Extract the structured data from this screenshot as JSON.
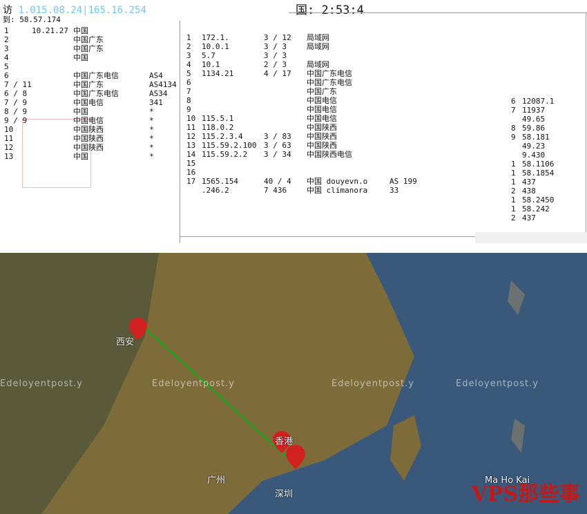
{
  "window": {
    "title_prefix": "访",
    "title_ip": "1.015.08.24|165.16.254",
    "subtitle": "到: 58.57.174",
    "title2": "国: 2:53:4"
  },
  "trace": {
    "left_rows": [
      {
        "hop": "1",
        "ip": "10.21.27",
        "geo": "中国",
        "asn": ""
      },
      {
        "hop": "2",
        "ip": "",
        "geo": "中国广东",
        "asn": ""
      },
      {
        "hop": "3",
        "ip": "",
        "geo": "中国广东",
        "asn": ""
      },
      {
        "hop": "4",
        "ip": "",
        "geo": "中国",
        "asn": ""
      },
      {
        "hop": "5",
        "ip": "",
        "geo": "",
        "asn": ""
      },
      {
        "hop": "6",
        "ip": "",
        "geo": "中国广东电信",
        "asn": "AS4"
      },
      {
        "hop": "7 / 11",
        "ip": "",
        "geo": "中国广东",
        "asn": "AS4134"
      },
      {
        "hop": "6 / 8",
        "ip": "",
        "geo": "中国广东电信",
        "asn": "AS34"
      },
      {
        "hop": "7 / 9",
        "ip": "",
        "geo": "中国电信",
        "asn": "341"
      },
      {
        "hop": "8 / 9",
        "ip": "",
        "geo": "中国",
        "asn": "*"
      },
      {
        "hop": "9 / 9",
        "ip": "",
        "geo": "中国电信",
        "asn": "*"
      },
      {
        "hop": "10",
        "ip": "",
        "geo": "中国陕西",
        "asn": "*"
      },
      {
        "hop": "11",
        "ip": "",
        "geo": "中国陕西",
        "asn": "*"
      },
      {
        "hop": "12",
        "ip": "",
        "geo": "中国陕西",
        "asn": "*"
      },
      {
        "hop": "13",
        "ip": "",
        "geo": "中国",
        "asn": "*"
      }
    ],
    "mid_rows": [
      {
        "hop": "1",
        "ip": "172.1.",
        "loss": "3 / 12",
        "geo": "局域网"
      },
      {
        "hop": "2",
        "ip": "10.0.1",
        "loss": "3 / 3",
        "geo": "局域网"
      },
      {
        "hop": "3",
        "ip": "5.7",
        "loss": "3 / 3",
        "geo": ""
      },
      {
        "hop": "4",
        "ip": "10.1",
        "loss": "2 / 3",
        "geo": "局域网"
      },
      {
        "hop": "5",
        "ip": "1134.21",
        "loss": "4 / 17",
        "geo": "中国广东电信"
      },
      {
        "hop": "6",
        "ip": "",
        "loss": "",
        "geo": "中国广东电信"
      },
      {
        "hop": "7",
        "ip": "",
        "loss": "",
        "geo": "中国广东"
      },
      {
        "hop": "8",
        "ip": "",
        "loss": "",
        "geo": "中国电信"
      },
      {
        "hop": "9",
        "ip": "",
        "loss": "",
        "geo": "中国电信"
      },
      {
        "hop": "10",
        "ip": "115.5.1",
        "loss": "",
        "geo": "中国电信"
      },
      {
        "hop": "11",
        "ip": "118.0.2",
        "loss": "",
        "geo": "中国陕西"
      },
      {
        "hop": "12",
        "ip": "115.2.3.4",
        "loss": "3 / 83",
        "geo": "中国陕西"
      },
      {
        "hop": "13",
        "ip": "115.59.2.100",
        "loss": "3 / 63",
        "geo": "中国陕西"
      },
      {
        "hop": "14",
        "ip": "115.59.2.2",
        "loss": "3 / 34",
        "geo": "中国陕西电信"
      },
      {
        "hop": "15",
        "ip": "",
        "loss": "",
        "geo": ""
      },
      {
        "hop": "16",
        "ip": "",
        "loss": "",
        "geo": ""
      },
      {
        "hop": "17",
        "ip": "1565.154",
        "loss": "40 / 4",
        "geo": "中国 douyevn.o",
        "asn": "AS 199"
      },
      {
        "hop": "",
        "ip": ".246.2",
        "loss": "7 436",
        "geo": "中国 climanora",
        "asn": "33"
      }
    ],
    "right_rows": [
      {
        "hop": "6",
        "ip": "12087.1"
      },
      {
        "hop": "7",
        "ip": "11937"
      },
      {
        "hop": "",
        "ip": "49.65"
      },
      {
        "hop": "8",
        "ip": "59.86"
      },
      {
        "hop": "9",
        "ip": "58.181"
      },
      {
        "hop": "",
        "ip": "49.23"
      },
      {
        "hop": "",
        "ip": "9.430"
      },
      {
        "hop": "1",
        "ip": "58.1106"
      },
      {
        "hop": "1",
        "ip": "58.1854"
      },
      {
        "hop": "1",
        "ip": "437"
      },
      {
        "hop": "2",
        "ip": "438"
      },
      {
        "hop": "1",
        "ip": "58.2450"
      },
      {
        "hop": "1",
        "ip": "58.242"
      },
      {
        "hop": "2",
        "ip": "437"
      }
    ]
  },
  "map": {
    "labels": [
      "西安",
      "广州",
      "深圳",
      "香港",
      "Ma Ho Kai"
    ],
    "watermark": "Edeloyentpost.y",
    "brand": "VPS那些事",
    "colors": {
      "land": "#7d6b3a",
      "sea": "#39587a",
      "route": "#1aa51a",
      "pin": "#d32020"
    }
  }
}
